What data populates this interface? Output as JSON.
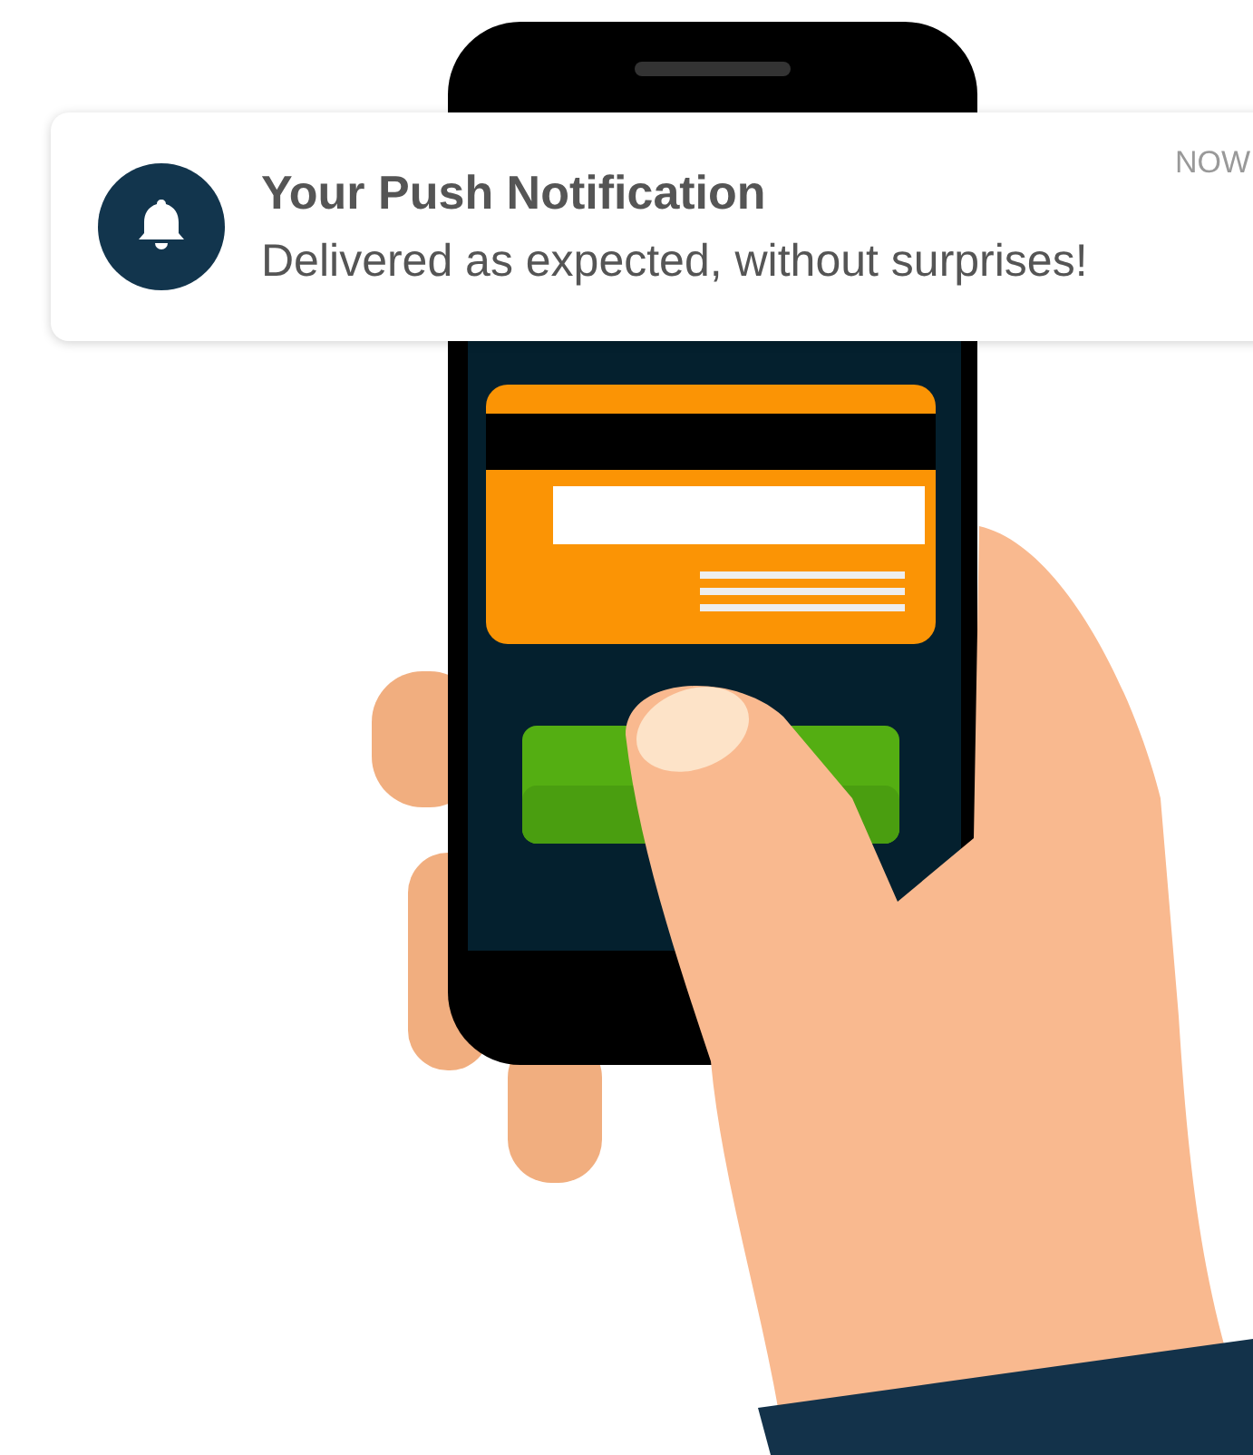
{
  "notification": {
    "title": "Your Push Notification",
    "message": "Delivered as expected, without surprises!",
    "time": "NOW"
  }
}
